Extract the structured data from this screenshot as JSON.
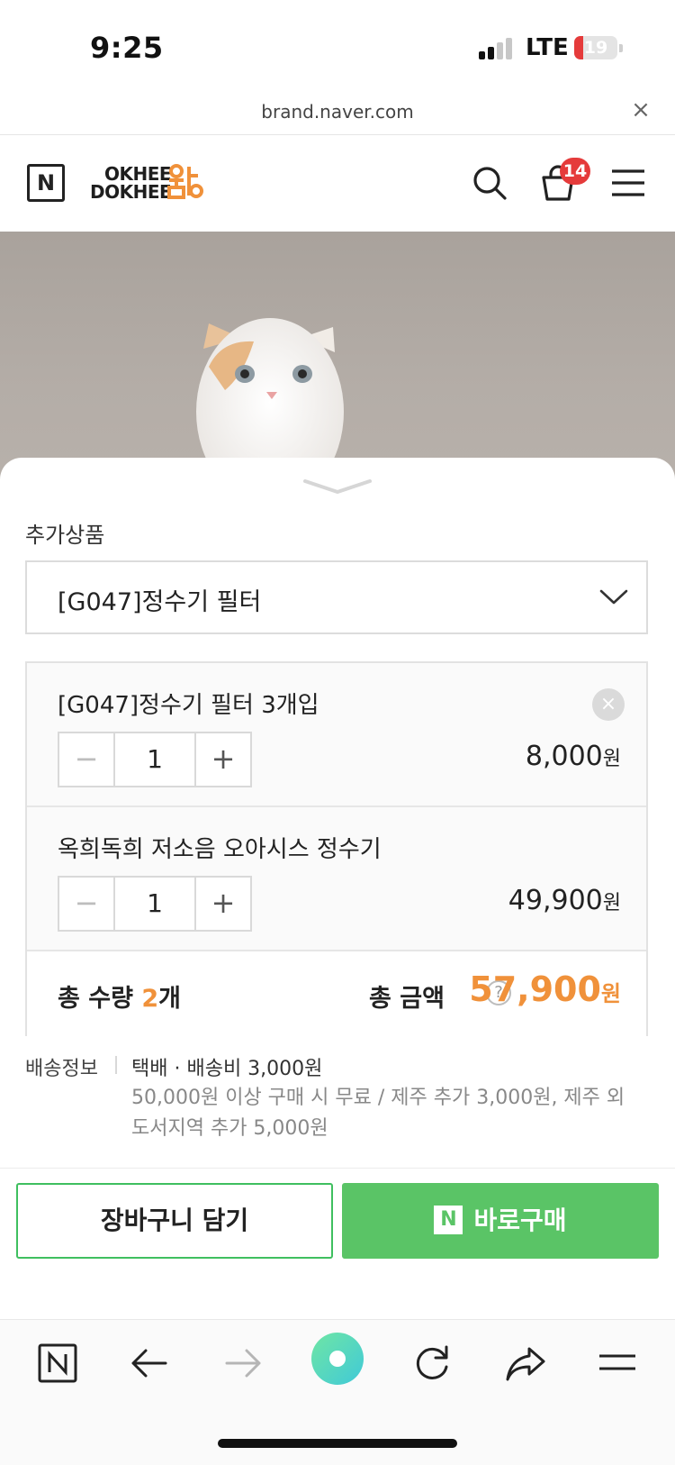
{
  "status_bar": {
    "time": "9:25",
    "network": "LTE",
    "battery_level": "19",
    "battery_fraction": 0.19,
    "battery_color": "#e53b3b"
  },
  "url_bar": {
    "url": "brand.naver.com",
    "close_icon": "close-icon"
  },
  "header": {
    "naver_logo": "N",
    "brand_logo_line1": "OKHEE",
    "brand_logo_line2": "DOKHEE",
    "brand_logo_mark": "옥희",
    "cart_count": "14",
    "icons": [
      "search-icon",
      "shopping-bag-icon",
      "hamburger-menu-icon"
    ]
  },
  "sheet": {
    "section_label": "추가상품",
    "select_value": "[G047]정수기 필터",
    "options": [
      {
        "name": "[G047]정수기 필터 3개입",
        "qty": "1",
        "price": "8,000",
        "won": "원",
        "removable": true
      },
      {
        "name": "옥희독희 저소음 오아시스 정수기",
        "qty": "1",
        "price": "49,900",
        "won": "원",
        "removable": false
      }
    ],
    "stepper_minus": "−",
    "stepper_plus": "+",
    "total_qty_prefix": "총 수량 ",
    "total_qty_num": "2",
    "total_qty_suffix": "개",
    "total_label": "총 금액",
    "help_symbol": "?",
    "total_price": "57,900",
    "total_won": "원",
    "accent_color": "#f0913a"
  },
  "shipping": {
    "label": "배송정보",
    "main": "택배 · 배송비 3,000원",
    "detail": "50,000원 이상 구매 시 무료 / 제주 추가 3,000원, 제주 외 도서지역 추가 5,000원"
  },
  "actions": {
    "cart_button": "장바구니 담기",
    "buy_button": "바로구매",
    "buy_badge": "N",
    "brand_green": "#5ac466"
  },
  "browser_toolbar": {
    "n_button": "N",
    "icons": [
      "naver-n-icon",
      "back-arrow-icon",
      "forward-arrow-icon",
      "green-dot-home-icon",
      "reload-icon",
      "share-icon",
      "menu-icon"
    ]
  }
}
